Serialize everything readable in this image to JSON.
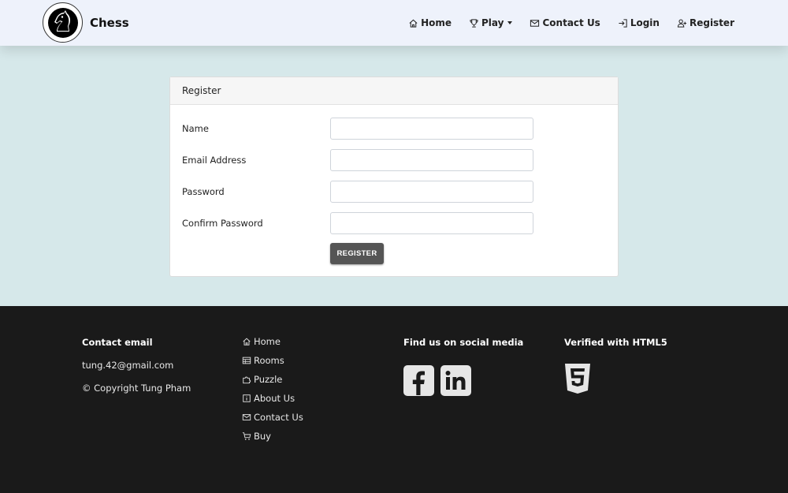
{
  "navbar": {
    "brand": "Chess",
    "items": [
      {
        "label": "Home",
        "icon": "home-icon"
      },
      {
        "label": "Play",
        "icon": "trophy-icon"
      },
      {
        "label": "Contact Us",
        "icon": "envelope-icon"
      },
      {
        "label": "Login",
        "icon": "login-icon"
      },
      {
        "label": "Register",
        "icon": "user-plus-icon"
      }
    ]
  },
  "form": {
    "title": "Register",
    "fields": [
      {
        "label": "Name",
        "value": ""
      },
      {
        "label": "Email Address",
        "value": ""
      },
      {
        "label": "Password",
        "value": ""
      },
      {
        "label": "Confirm Password",
        "value": ""
      }
    ],
    "submit_label": "REGISTER"
  },
  "footer": {
    "contact_heading": "Contact email",
    "email": "tung.42@gmail.com",
    "copyright": "© Copyright Tung Pham",
    "links": [
      {
        "label": "Home",
        "icon": "home-icon"
      },
      {
        "label": "Rooms",
        "icon": "table-icon"
      },
      {
        "label": "Puzzle",
        "icon": "puzzle-icon"
      },
      {
        "label": "About Us",
        "icon": "info-icon"
      },
      {
        "label": "Contact Us",
        "icon": "envelope-icon"
      },
      {
        "label": "Buy",
        "icon": "cart-icon"
      }
    ],
    "social_heading": "Find us on social media",
    "social": [
      "facebook-icon",
      "linkedin-icon"
    ],
    "verified_heading": "Verified with HTML5",
    "verified_icon": "html5-icon"
  },
  "colors": {
    "navbar_bg": "#eef2fb",
    "page_bg": "#d6e8ea",
    "footer_bg": "#1a1a1a",
    "button_bg": "#555555"
  }
}
